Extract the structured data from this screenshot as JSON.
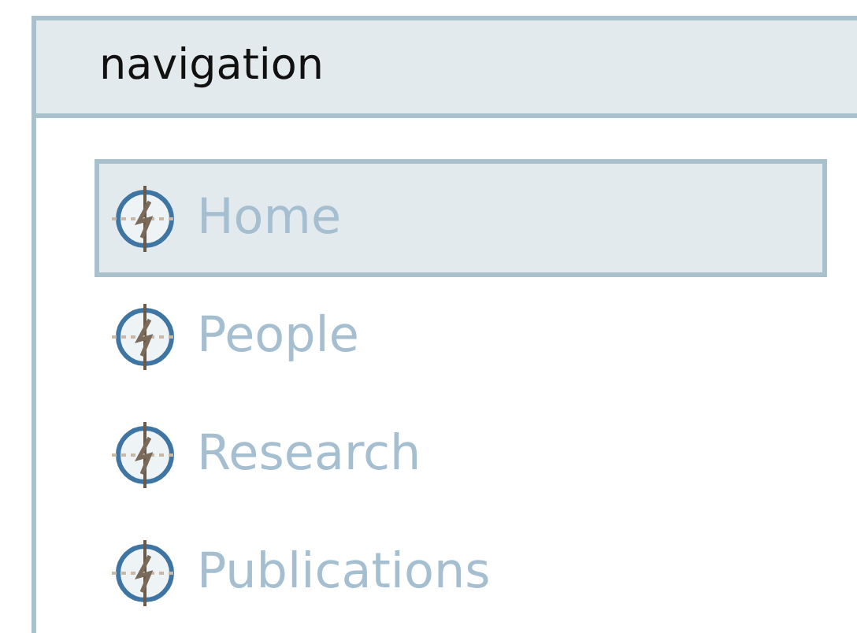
{
  "panel": {
    "title": "navigation"
  },
  "items": [
    {
      "label": "Home",
      "selected": true
    },
    {
      "label": "People",
      "selected": false
    },
    {
      "label": "Research",
      "selected": false
    },
    {
      "label": "Publications",
      "selected": false
    }
  ]
}
